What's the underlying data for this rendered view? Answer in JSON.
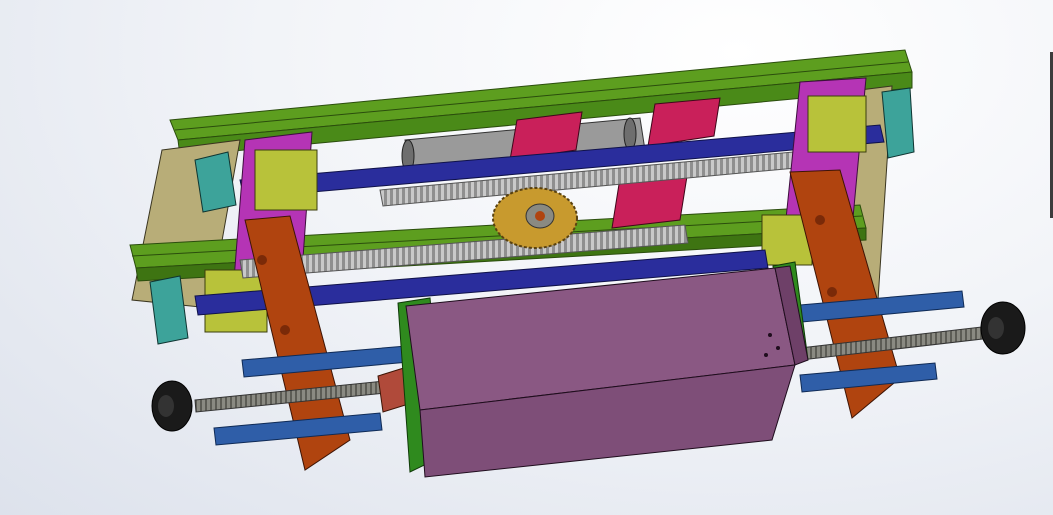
{
  "viewport": {
    "background_top": "#ffffff",
    "background_bottom": "#dde2ec"
  },
  "model": {
    "description_colors": {
      "frame_green": "#5d9e1f",
      "frame_green_dark": "#3e7412",
      "side_plate_tan": "#b8ad78",
      "carriage_magenta": "#b534b5",
      "block_olive": "#b8c23a",
      "shaft_blue": "#2a2d9c",
      "rail_blue": "#2f5ea8",
      "bracket_teal": "#3da39a",
      "mount_pink": "#c9205a",
      "end_plate_orange": "#b0440f",
      "flange_green": "#2f8a1e",
      "housing_mauve": "#8a5883",
      "rack_gray": "#c9c9c9",
      "gear_gold": "#c89a2e",
      "screw_gray": "#8a8a82",
      "knob_black": "#1a1a1a"
    }
  }
}
